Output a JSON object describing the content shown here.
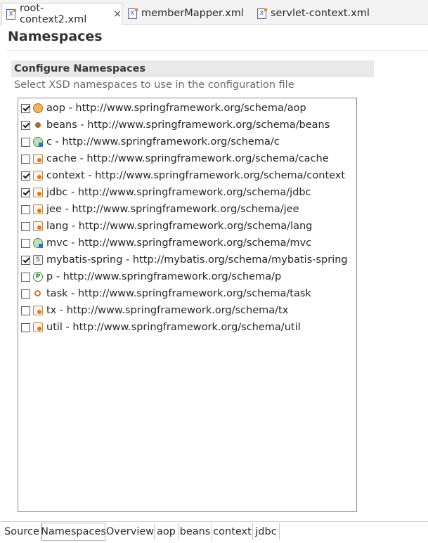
{
  "editor_tabs": [
    {
      "label": "root-context2.xml",
      "active": true,
      "closable": true
    },
    {
      "label": "memberMapper.xml",
      "active": false
    },
    {
      "label": "servlet-context.xml",
      "active": false
    }
  ],
  "page": {
    "title": "Namespaces",
    "section_title": "Configure Namespaces",
    "section_description": "Select XSD namespaces to use in the configuration file"
  },
  "namespaces": [
    {
      "label": "aop - http://www.springframework.org/schema/aop",
      "checked": true,
      "icon": "aop-icon"
    },
    {
      "label": "beans - http://www.springframework.org/schema/beans",
      "checked": true,
      "icon": "bean-icon"
    },
    {
      "label": "c - http://www.springframework.org/schema/c",
      "checked": false,
      "icon": "globe-icon"
    },
    {
      "label": "cache - http://www.springframework.org/schema/cache",
      "checked": false,
      "icon": "doc-icon"
    },
    {
      "label": "context - http://www.springframework.org/schema/context",
      "checked": true,
      "icon": "doc-icon"
    },
    {
      "label": "jdbc - http://www.springframework.org/schema/jdbc",
      "checked": true,
      "icon": "doc-icon"
    },
    {
      "label": "jee - http://www.springframework.org/schema/jee",
      "checked": false,
      "icon": "doc-icon"
    },
    {
      "label": "lang - http://www.springframework.org/schema/lang",
      "checked": false,
      "icon": "doc-icon"
    },
    {
      "label": "mvc - http://www.springframework.org/schema/mvc",
      "checked": false,
      "icon": "globe-icon"
    },
    {
      "label": "mybatis-spring - http://mybatis.org/schema/mybatis-spring",
      "checked": true,
      "icon": "s-icon"
    },
    {
      "label": "p - http://www.springframework.org/schema/p",
      "checked": false,
      "icon": "p-icon"
    },
    {
      "label": "task - http://www.springframework.org/schema/task",
      "checked": false,
      "icon": "gear-icon"
    },
    {
      "label": "tx - http://www.springframework.org/schema/tx",
      "checked": false,
      "icon": "doc-icon"
    },
    {
      "label": "util - http://www.springframework.org/schema/util",
      "checked": false,
      "icon": "doc-icon"
    }
  ],
  "page_tabs": [
    {
      "label": "Source",
      "active": false
    },
    {
      "label": "Namespaces",
      "active": true
    },
    {
      "label": "Overview",
      "active": false
    },
    {
      "label": "aop",
      "active": false
    },
    {
      "label": "beans",
      "active": false
    },
    {
      "label": "context",
      "active": false
    },
    {
      "label": "jdbc",
      "active": false
    }
  ],
  "icon_glyphs": {
    "s_icon_letter": "S",
    "p_icon_letter": "P",
    "xml_icon_letter": "X",
    "close_glyph": "×"
  }
}
